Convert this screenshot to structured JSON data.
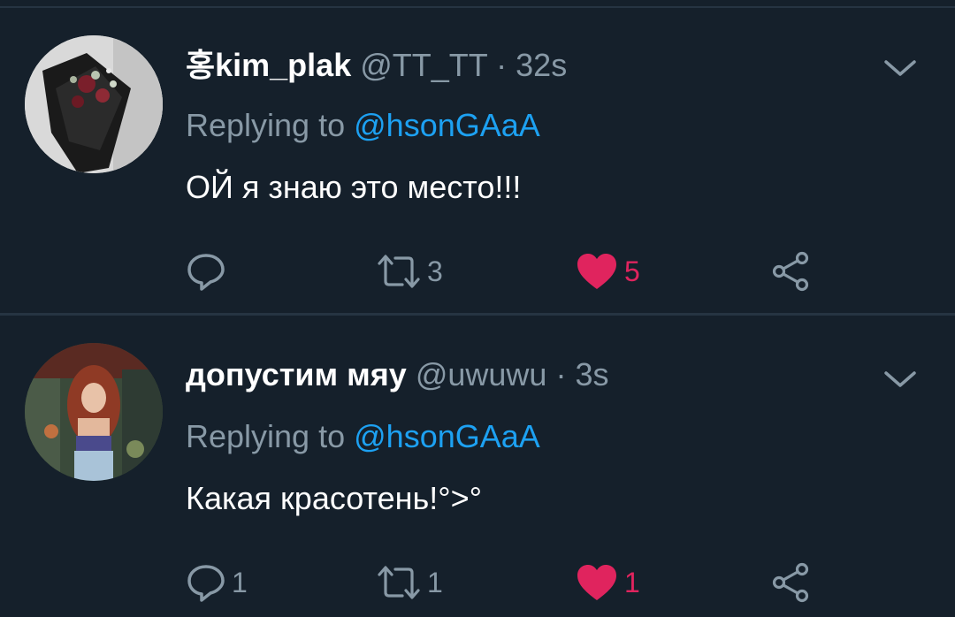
{
  "tweets": [
    {
      "name": "홍kim_plak",
      "handle": "@TT_TT",
      "separator": "·",
      "time": "32s",
      "replying_prefix": "Replying to",
      "replying_mention": "@hsonGAaA",
      "text": "ОЙ я знаю это место!!!",
      "reply_count": "",
      "retweet_count": "3",
      "like_count": "5",
      "liked": true
    },
    {
      "name": "допустим мяу",
      "handle": "@uwuwu",
      "separator": "·",
      "time": "3s",
      "replying_prefix": "Replying to",
      "replying_mention": "@hsonGAaA",
      "text": "Какая красотень!°>°",
      "reply_count": "1",
      "retweet_count": "1",
      "like_count": "1",
      "liked": true
    }
  ],
  "colors": {
    "background": "#15202b",
    "divider": "#263442",
    "text_primary": "#ffffff",
    "text_secondary": "#8899a6",
    "link": "#1da1f2",
    "like": "#e0245e"
  },
  "icons": {
    "reply": "reply-icon",
    "retweet": "retweet-icon",
    "like": "heart-icon",
    "share": "share-icon",
    "menu": "chevron-down-icon"
  }
}
